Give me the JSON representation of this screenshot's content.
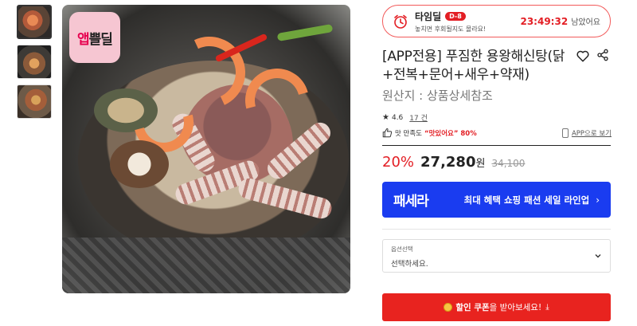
{
  "gallery": {
    "brand_badge": {
      "part1": "앱",
      "part2": "쁠딜"
    },
    "thumbnails": [
      "thumb-1",
      "thumb-2",
      "thumb-3"
    ]
  },
  "timedeal": {
    "title": "타임딜",
    "dday": "D-8",
    "subtitle": "놓치면 후회될지도 몰라요!",
    "timer": "23:49:32",
    "timer_suffix": "남았어요"
  },
  "product": {
    "title": "[APP전용] 푸짐한 용왕해신탕(닭+전복+문어+새우+약재)",
    "origin": "원산지 : 상품상세참조",
    "rating": "4.6",
    "review_count": "17 건",
    "satisfaction_label": "맛 만족도",
    "satisfaction_value": "“맛있어요” 80%",
    "app_link": "APP으로 보기"
  },
  "price": {
    "discount": "20%",
    "sale": "27,280",
    "unit": "원",
    "original": "34,100"
  },
  "banner": {
    "logo": "패세라",
    "text": "최대 혜택 쇼핑 패션 세일 라인업",
    "chevron": "›"
  },
  "option": {
    "label": "옵션선택",
    "placeholder": "선택하세요."
  },
  "coupon": {
    "bold": "할인 쿠폰",
    "rest": "을 받아보세요!",
    "icon": "⤓"
  },
  "colors": {
    "accent_red": "#e31e24",
    "banner_blue": "#1a3cf0",
    "coupon_red": "#e8231f"
  }
}
